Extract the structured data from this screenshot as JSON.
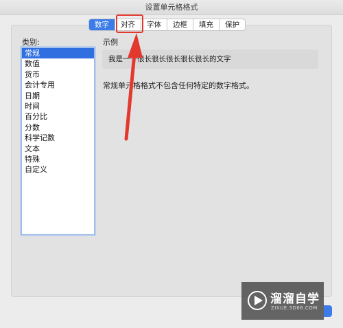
{
  "window": {
    "title": "设置单元格格式"
  },
  "tabs": [
    {
      "label": "数字",
      "active": true
    },
    {
      "label": "对齐",
      "active": false
    },
    {
      "label": "字体",
      "active": false
    },
    {
      "label": "边框",
      "active": false
    },
    {
      "label": "填充",
      "active": false
    },
    {
      "label": "保护",
      "active": false
    }
  ],
  "category": {
    "label": "类别:",
    "selected": "常规",
    "items": [
      "常规",
      "数值",
      "货币",
      "会计专用",
      "日期",
      "时间",
      "百分比",
      "分数",
      "科学记数",
      "文本",
      "特殊",
      "自定义"
    ]
  },
  "sample": {
    "label": "示例",
    "text": "我是一个很长很长很长很长很长的文字"
  },
  "description": "常规单元格格式不包含任何特定的数字格式。",
  "watermark": {
    "title": "溜溜自学",
    "subtitle": "ZIXUE.3D66.COM"
  },
  "colors": {
    "accent": "#3b7ce9",
    "annotation": "#e2382e"
  }
}
